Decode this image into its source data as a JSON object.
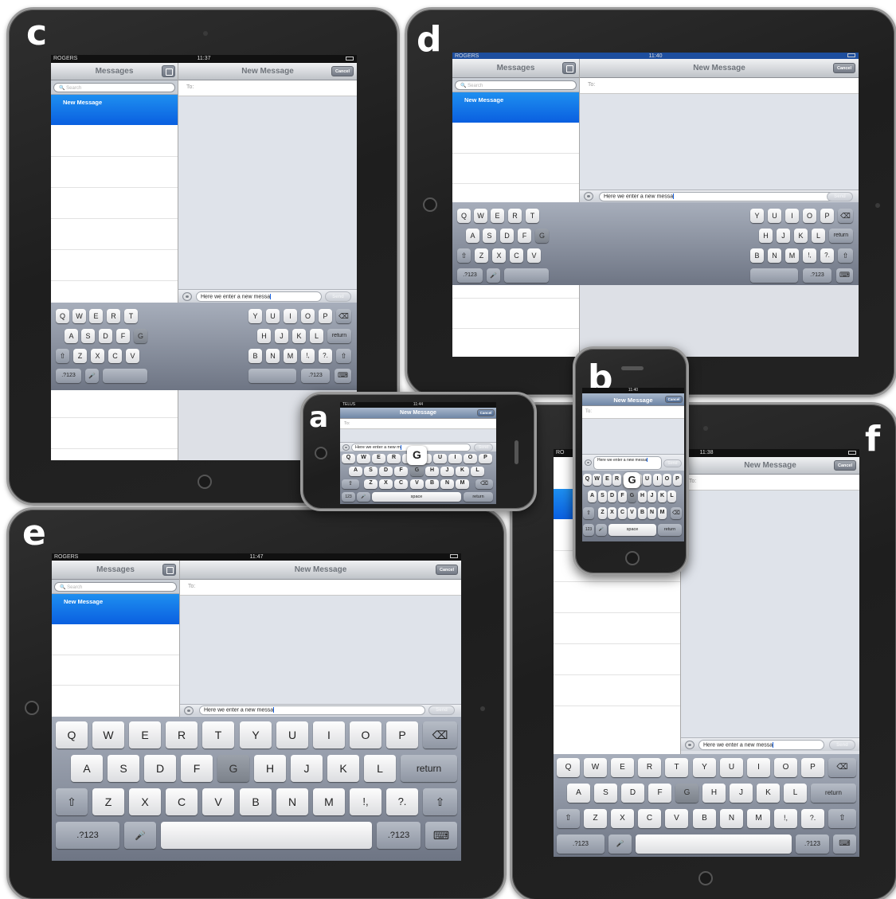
{
  "panels": {
    "a": {
      "label": "a",
      "carrier": "TELUS",
      "time": "11:44",
      "title": "New Message",
      "cancel": "Cancel",
      "to": "To:",
      "text": "Here we enter a new m",
      "send": "Send",
      "popup": "G",
      "rows": [
        [
          "Q",
          "W",
          "E",
          "R",
          "T",
          "Y",
          "U",
          "I",
          "O",
          "P"
        ],
        [
          "A",
          "S",
          "D",
          "F",
          "G",
          "H",
          "J",
          "K",
          "L"
        ],
        [
          "⇧",
          "Z",
          "X",
          "C",
          "V",
          "B",
          "N",
          "M",
          "⌫"
        ],
        [
          "123",
          "🎤",
          "space",
          "return"
        ]
      ]
    },
    "b": {
      "label": "b",
      "time": "11:40",
      "title": "New Message",
      "cancel": "Cancel",
      "to": "To:",
      "text": "Here we enter a new messa",
      "send": "Send",
      "popup": "G",
      "rows": [
        [
          "Q",
          "W",
          "E",
          "R",
          "T",
          "Y",
          "U",
          "I",
          "O",
          "P"
        ],
        [
          "A",
          "S",
          "D",
          "F",
          "G",
          "H",
          "J",
          "K",
          "L"
        ],
        [
          "⇧",
          "Z",
          "X",
          "C",
          "V",
          "B",
          "N",
          "M",
          "⌫"
        ],
        [
          "123",
          "🎤",
          "space",
          "return"
        ]
      ]
    },
    "c": {
      "label": "c",
      "carrier": "ROGERS",
      "time": "11:37",
      "sidebar_title": "Messages",
      "search": "Search",
      "selected": "New Message",
      "title": "New Message",
      "cancel": "Cancel",
      "to": "To:",
      "text": "Here we enter a new messa",
      "send": "Send",
      "left_rows": [
        [
          "Q",
          "W",
          "E",
          "R",
          "T"
        ],
        [
          "A",
          "S",
          "D",
          "F",
          "G"
        ],
        [
          "⇧",
          "Z",
          "X",
          "C",
          "V"
        ],
        [
          ".?123",
          "🎤",
          ""
        ]
      ],
      "right_rows": [
        [
          "Y",
          "U",
          "I",
          "O",
          "P",
          "⌫"
        ],
        [
          "H",
          "J",
          "K",
          "L",
          "return"
        ],
        [
          "B",
          "N",
          "M",
          "!,",
          "?.",
          "⇧"
        ],
        [
          "",
          ".?123",
          "⌨"
        ]
      ]
    },
    "d": {
      "label": "d",
      "carrier": "ROGERS",
      "time": "11:40",
      "sidebar_title": "Messages",
      "search": "Search",
      "selected": "New Message",
      "title": "New Message",
      "cancel": "Cancel",
      "to": "To:",
      "text": "Here we enter a new messa",
      "send": "Send",
      "left_rows": [
        [
          "Q",
          "W",
          "E",
          "R",
          "T"
        ],
        [
          "A",
          "S",
          "D",
          "F",
          "G"
        ],
        [
          "⇧",
          "Z",
          "X",
          "C",
          "V"
        ],
        [
          ".?123",
          "🎤",
          ""
        ]
      ],
      "right_rows": [
        [
          "Y",
          "U",
          "I",
          "O",
          "P",
          "⌫"
        ],
        [
          "H",
          "J",
          "K",
          "L",
          "return"
        ],
        [
          "B",
          "N",
          "M",
          "!,",
          "?.",
          "⇧"
        ],
        [
          "",
          ".?123",
          "⌨"
        ]
      ]
    },
    "e": {
      "label": "e",
      "carrier": "ROGERS",
      "time": "11:47",
      "sidebar_title": "Messages",
      "search": "Search",
      "selected": "New Message",
      "title": "New Message",
      "cancel": "Cancel",
      "to": "To:",
      "text": "Here we enter a new messa",
      "send": "Send",
      "rows": [
        [
          "Q",
          "W",
          "E",
          "R",
          "T",
          "Y",
          "U",
          "I",
          "O",
          "P",
          "⌫"
        ],
        [
          "A",
          "S",
          "D",
          "F",
          "G",
          "H",
          "J",
          "K",
          "L",
          "return"
        ],
        [
          "⇧",
          "Z",
          "X",
          "C",
          "V",
          "B",
          "N",
          "M",
          "!,",
          "?.",
          "⇧"
        ],
        [
          ".?123",
          "🎤",
          "",
          ".?123",
          "⌨"
        ]
      ]
    },
    "f": {
      "label": "f",
      "carrier": "RO",
      "time": "11:38",
      "title": "New Message",
      "cancel": "Cancel",
      "to": "To:",
      "text": "Here we enter a new messa",
      "send": "Send",
      "rows": [
        [
          "Q",
          "W",
          "E",
          "R",
          "T",
          "Y",
          "U",
          "I",
          "O",
          "P",
          "⌫"
        ],
        [
          "A",
          "S",
          "D",
          "F",
          "G",
          "H",
          "J",
          "K",
          "L",
          "return"
        ],
        [
          "⇧",
          "Z",
          "X",
          "C",
          "V",
          "B",
          "N",
          "M",
          "!,",
          "?.",
          "⇧"
        ],
        [
          ".?123",
          "🎤",
          "",
          ".?123",
          "⌨"
        ]
      ]
    }
  }
}
